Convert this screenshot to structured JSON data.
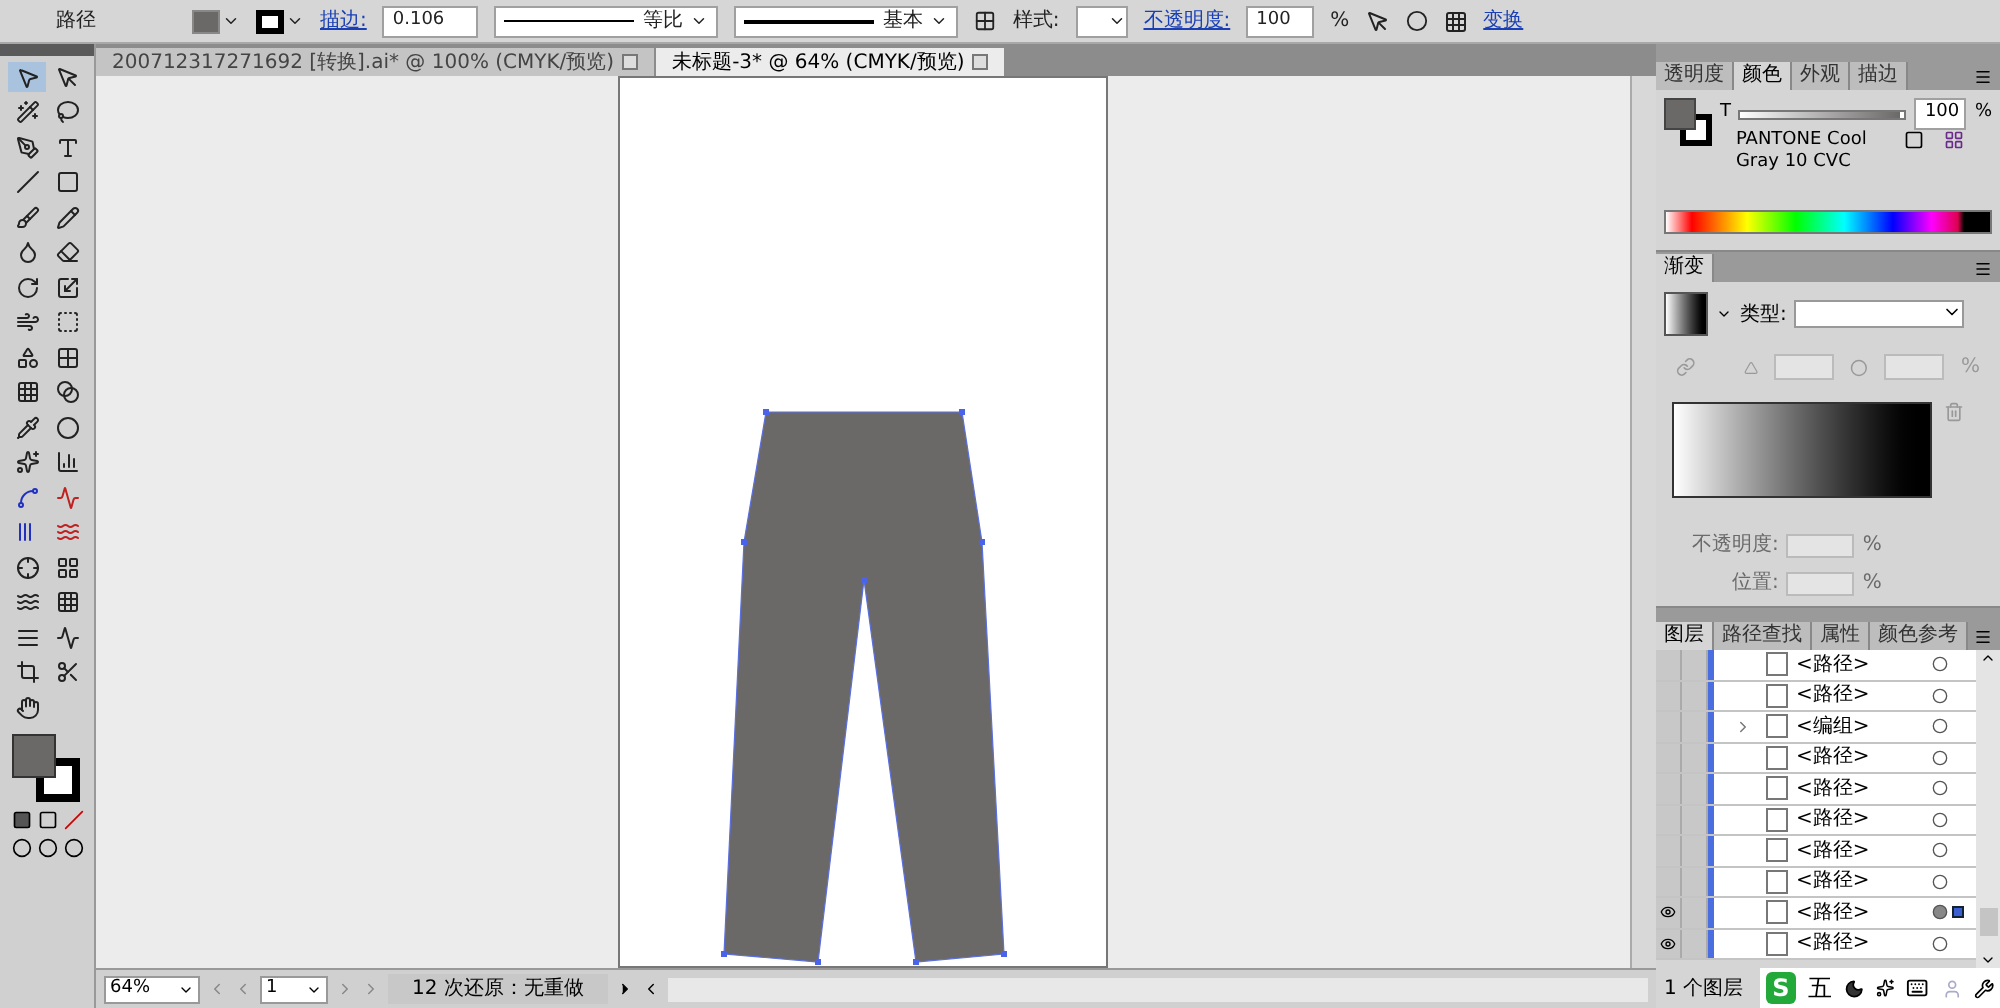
{
  "control_bar": {
    "object_type": "路径",
    "stroke_label": "描边:",
    "stroke_weight": "0.106",
    "profile": "等比",
    "brush": "基本",
    "style_label": "样式:",
    "opacity_label": "不透明度:",
    "opacity": "100",
    "percent": "%",
    "transform_link": "变换"
  },
  "documents": [
    {
      "title": "200712317271692 [转换].ai* @ 100% (CMYK/预览)",
      "selected": false
    },
    {
      "title": "未标题-3* @ 64% (CMYK/预览)",
      "selected": true
    }
  ],
  "tools": [
    {
      "selected": true
    },
    {
      "selected": false
    },
    {
      "selected": false
    },
    {
      "selected": false
    },
    {
      "selected": false
    },
    {
      "selected": false
    },
    {
      "selected": false
    },
    {
      "selected": false
    },
    {
      "selected": false
    },
    {
      "selected": false
    },
    {
      "selected": false
    },
    {
      "selected": false
    },
    {
      "selected": false
    },
    {
      "selected": false
    },
    {
      "selected": false
    },
    {
      "selected": false
    },
    {
      "selected": false
    },
    {
      "selected": false
    },
    {
      "selected": false
    },
    {
      "selected": false
    },
    {
      "selected": false
    },
    {
      "selected": false
    },
    {
      "selected": false
    },
    {
      "selected": false
    },
    {
      "selected": false
    },
    {
      "selected": false
    },
    {
      "selected": false
    },
    {
      "selected": false
    },
    {
      "selected": false
    },
    {
      "selected": false
    },
    {
      "selected": false
    },
    {
      "selected": false
    },
    {
      "selected": false
    },
    {
      "selected": false
    },
    {
      "selected": false
    },
    {
      "selected": false
    },
    {
      "selected": false
    }
  ],
  "color_panel": {
    "tabs": [
      {
        "label": "透明度",
        "selected": false
      },
      {
        "label": "颜色",
        "selected": true
      },
      {
        "label": "外观",
        "selected": false
      },
      {
        "label": "描边",
        "selected": false
      }
    ],
    "tint_label": "T",
    "level": 0.97,
    "tint": "100",
    "percent": "%",
    "swatch_name": "PANTONE Cool Gray 10 CVC"
  },
  "gradient_panel": {
    "tab": "渐变",
    "type_label": "类型:",
    "percent": "%",
    "opacity_label": "不透明度:",
    "location_label": "位置:"
  },
  "layers_panel": {
    "tabs": [
      {
        "label": "图层",
        "selected": true
      },
      {
        "label": "路径查找",
        "selected": false
      },
      {
        "label": "属性",
        "selected": false
      },
      {
        "label": "颜色参考",
        "selected": false
      }
    ],
    "rows": [
      {
        "name": "<路径>",
        "kind": "path",
        "visible": false,
        "selected": false
      },
      {
        "name": "<路径>",
        "kind": "path",
        "visible": false,
        "selected": false
      },
      {
        "name": "<编组>",
        "kind": "group",
        "visible": false,
        "selected": false
      },
      {
        "name": "<路径>",
        "kind": "path",
        "visible": false,
        "selected": false
      },
      {
        "name": "<路径>",
        "kind": "path",
        "visible": false,
        "selected": false
      },
      {
        "name": "<路径>",
        "kind": "path",
        "visible": false,
        "selected": false
      },
      {
        "name": "<路径>",
        "kind": "path",
        "visible": false,
        "selected": false
      },
      {
        "name": "<路径>",
        "kind": "path",
        "visible": false,
        "selected": false
      },
      {
        "name": "<路径>",
        "kind": "path",
        "visible": true,
        "selected": true
      },
      {
        "name": "<路径>",
        "kind": "path",
        "visible": true,
        "selected": false
      }
    ],
    "footer": "1 个图层"
  },
  "ime_bar": {
    "logo": "S",
    "mode": "五"
  },
  "status_bar": {
    "zoom": "64%",
    "artboard": "1",
    "message": "12 次还原：无重做"
  }
}
